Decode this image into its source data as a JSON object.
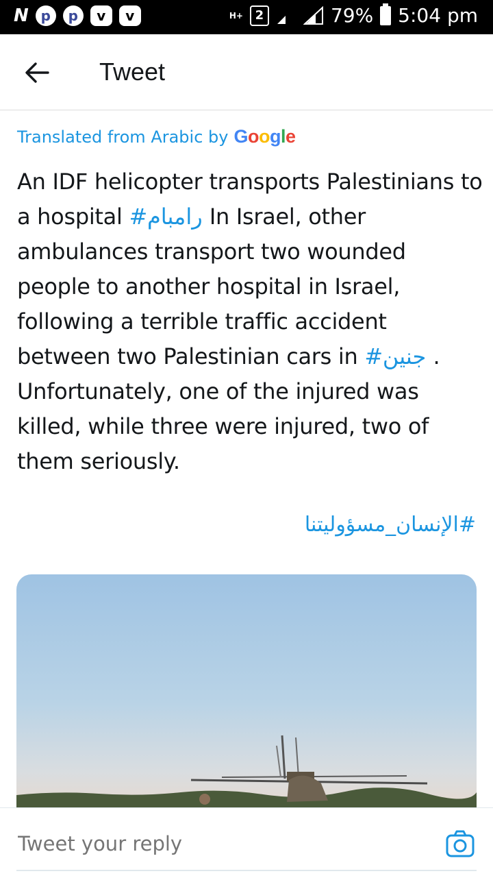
{
  "status_bar": {
    "left_icons": [
      "N",
      "p",
      "p",
      "v",
      "v"
    ],
    "network": "H+",
    "sim": "2",
    "battery": "79%",
    "time": "5:04 pm"
  },
  "header": {
    "title": "Tweet"
  },
  "translation": {
    "label": "Translated from Arabic by",
    "provider": "Google"
  },
  "tweet": {
    "seg1": "An IDF helicopter transports Palestinians to a hospital ",
    "tag1": "#رامبام",
    "seg2": " In Israel, other ambulances transport two wounded people to another hospital in Israel, following a terrible traffic accident between two Palestinian cars in ",
    "tag2": "#جنين",
    "seg3": " . Unfortunately, one of the injured was killed, while three were injured, two of them seriously.",
    "tag3": "#الإنسان_مسؤوليتنا"
  },
  "reply": {
    "placeholder": "Tweet your reply"
  },
  "colors": {
    "link": "#1b95e0",
    "text": "#14171a",
    "muted": "#657786"
  }
}
